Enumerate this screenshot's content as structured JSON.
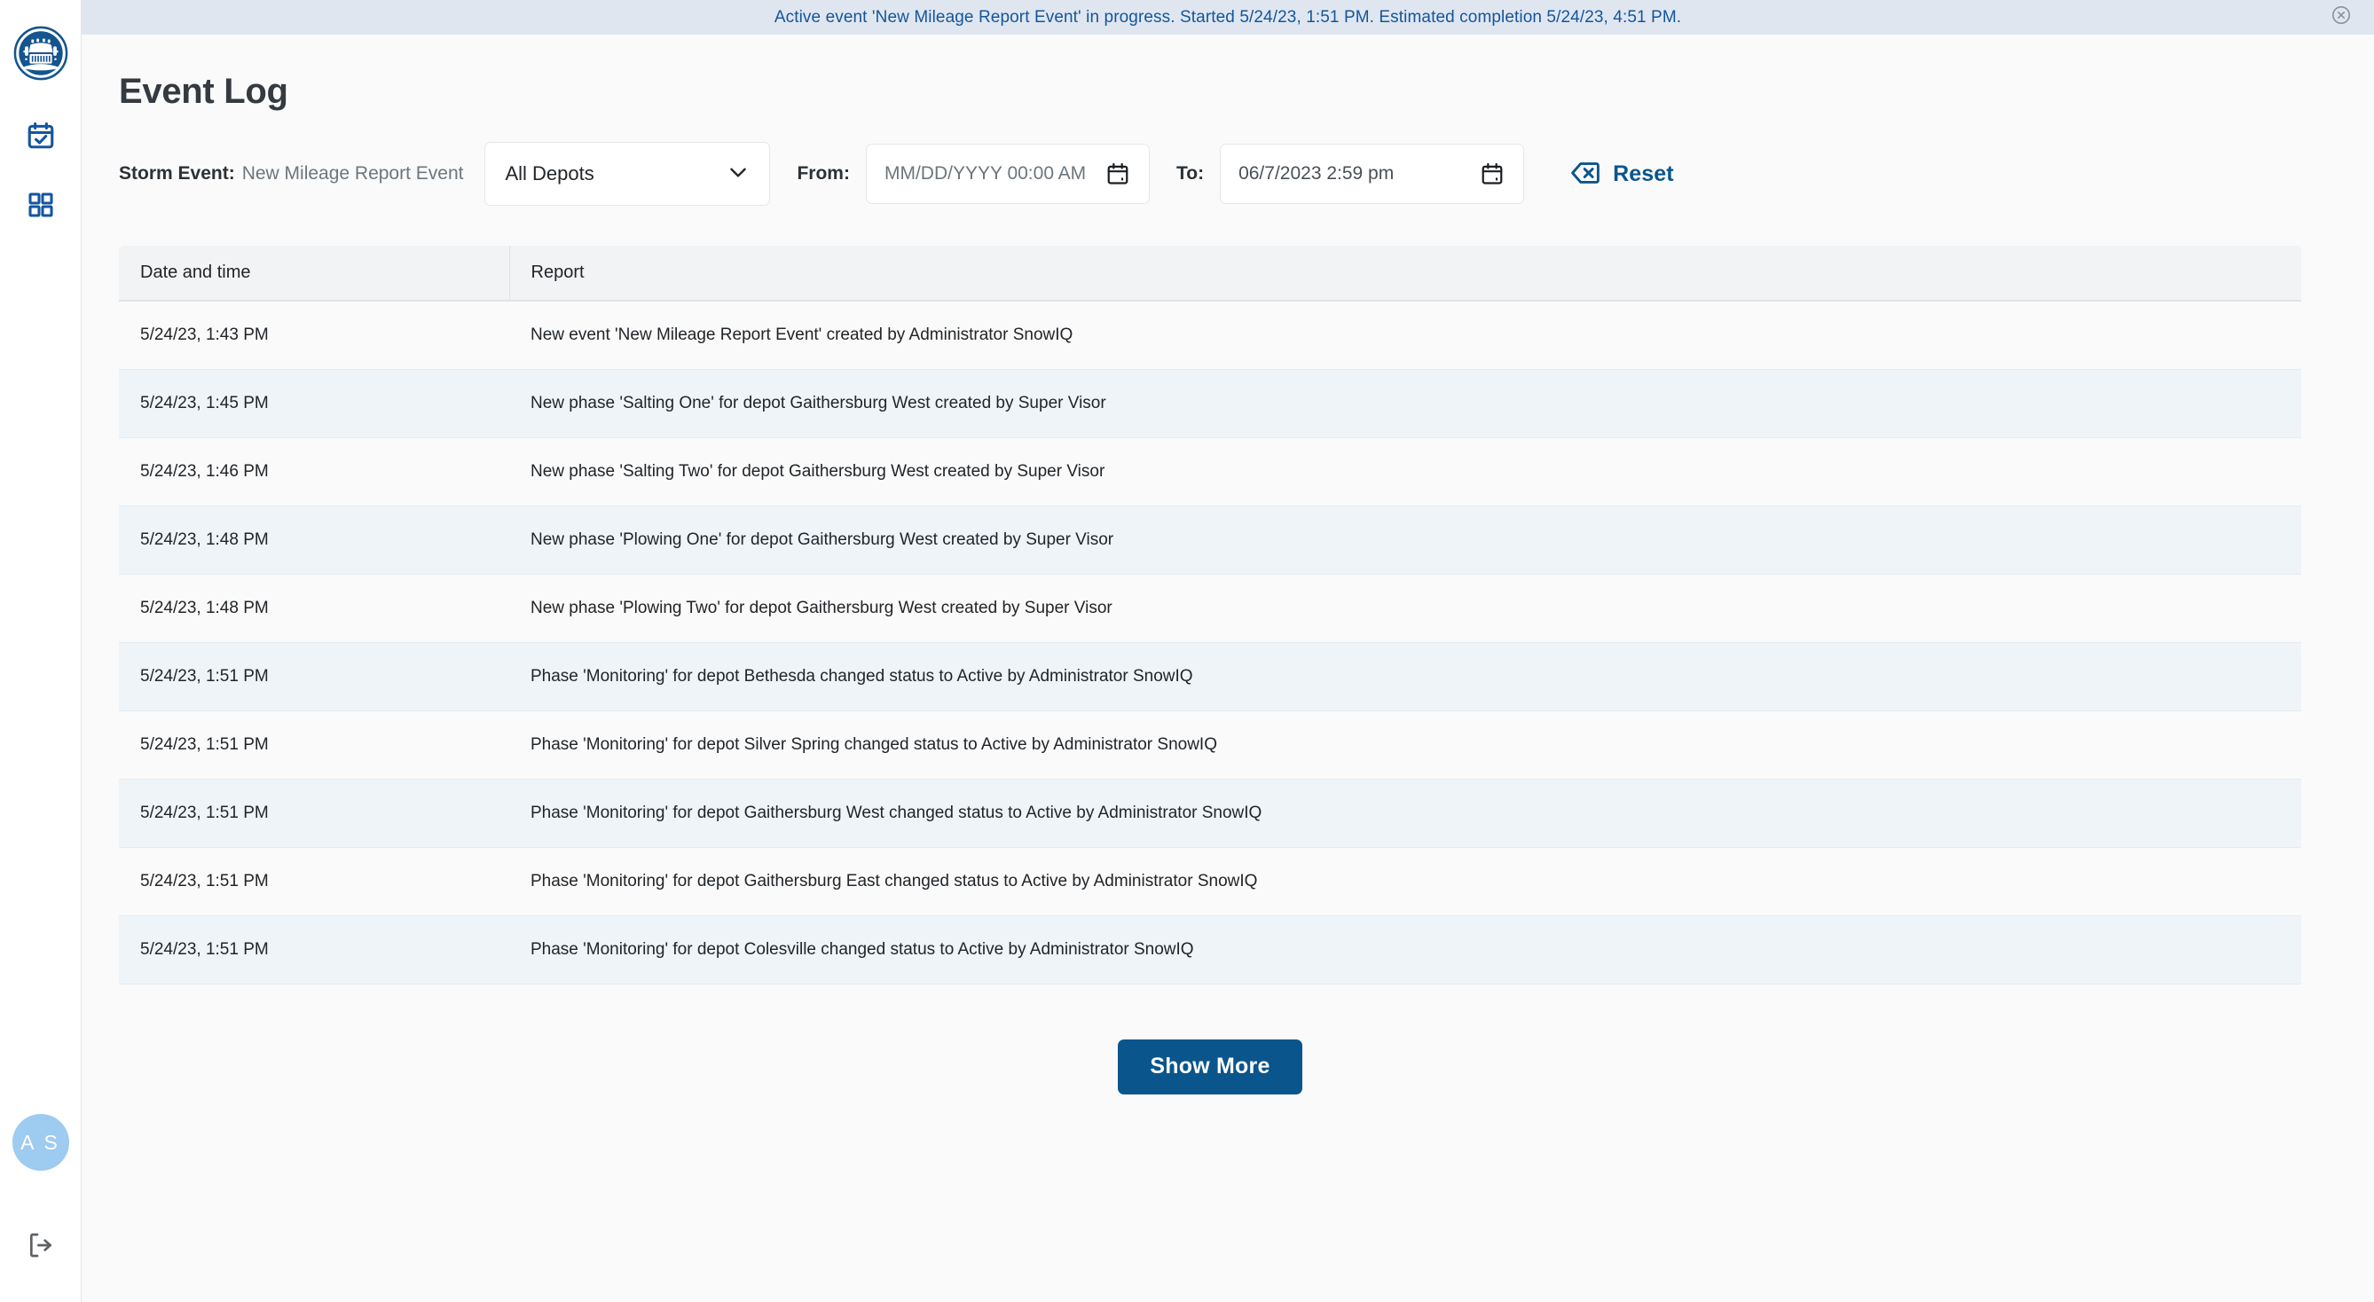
{
  "banner": {
    "text": "Active event 'New Mileage Report Event' in progress. Started 5/24/23, 1:51 PM. Estimated completion 5/24/23, 4:51 PM.",
    "close_icon": "close-circle-icon",
    "background_color": "#dfe6f0",
    "text_color": "#14559b"
  },
  "sidebar": {
    "logo_icon": "snowplow-truck-logo",
    "items": [
      {
        "icon": "calendar-check-icon",
        "name": "events"
      },
      {
        "icon": "grid-dashboard-icon",
        "name": "dashboard"
      }
    ],
    "avatar": {
      "initials": "A S",
      "color": "#9ecbf0"
    },
    "logout_icon": "logout-icon"
  },
  "page": {
    "title": "Event Log"
  },
  "filters": {
    "storm_event_label": "Storm Event:",
    "storm_event_value": "New Mileage Report Event",
    "depot_select": {
      "value": "All Depots",
      "options": [
        "All Depots"
      ],
      "chevron_icon": "chevron-down-icon"
    },
    "from_label": "From:",
    "from_value": "",
    "from_placeholder": "MM/DD/YYYY 00:00 AM",
    "to_label": "To:",
    "to_value": "06/7/2023 2:59 pm",
    "calendar_icon": "calendar-icon",
    "reset": {
      "label": "Reset",
      "icon": "backspace-delete-icon",
      "color": "#0a558c"
    }
  },
  "table": {
    "columns": [
      "Date and time",
      "Report"
    ],
    "rows": [
      {
        "datetime": "5/24/23, 1:43 PM",
        "report": "New event 'New Mileage Report Event' created by Administrator SnowIQ"
      },
      {
        "datetime": "5/24/23, 1:45 PM",
        "report": "New phase 'Salting One' for depot Gaithersburg West created by Super Visor"
      },
      {
        "datetime": "5/24/23, 1:46 PM",
        "report": "New phase 'Salting Two' for depot Gaithersburg West created by Super Visor"
      },
      {
        "datetime": "5/24/23, 1:48 PM",
        "report": "New phase 'Plowing One' for depot Gaithersburg West created by Super Visor"
      },
      {
        "datetime": "5/24/23, 1:48 PM",
        "report": "New phase 'Plowing Two' for depot Gaithersburg West created by Super Visor"
      },
      {
        "datetime": "5/24/23, 1:51 PM",
        "report": "Phase 'Monitoring' for depot Bethesda changed status to Active by Administrator SnowIQ"
      },
      {
        "datetime": "5/24/23, 1:51 PM",
        "report": "Phase 'Monitoring' for depot Silver Spring changed status to Active by Administrator SnowIQ"
      },
      {
        "datetime": "5/24/23, 1:51 PM",
        "report": "Phase 'Monitoring' for depot Gaithersburg West changed status to Active by Administrator SnowIQ"
      },
      {
        "datetime": "5/24/23, 1:51 PM",
        "report": "Phase 'Monitoring' for depot Gaithersburg East changed status to Active by Administrator SnowIQ"
      },
      {
        "datetime": "5/24/23, 1:51 PM",
        "report": "Phase 'Monitoring' for depot Colesville changed status to Active by Administrator SnowIQ"
      }
    ]
  },
  "footer": {
    "show_more_label": "Show More",
    "show_more_color": "#0a558c"
  }
}
